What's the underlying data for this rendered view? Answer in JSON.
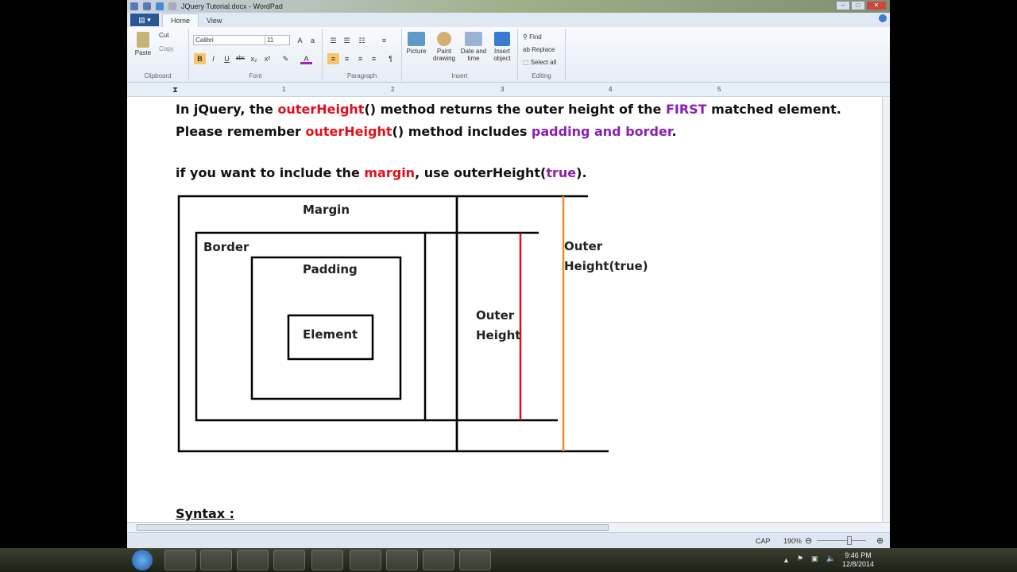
{
  "window": {
    "title": "JQuery Tutorial.docx - WordPad",
    "controls": [
      "–",
      "□",
      "✕"
    ]
  },
  "tabs": [
    {
      "label": "Home",
      "active": true
    },
    {
      "label": "View",
      "active": false
    }
  ],
  "ribbon": {
    "clipboard": {
      "label": "Clipboard",
      "paste": "Paste",
      "cut": "Cut",
      "copy": "Copy"
    },
    "font": {
      "label": "Font",
      "family": "Calibri",
      "size": "11",
      "bold": "B",
      "italic": "I",
      "underline": "U",
      "strike": "abc",
      "sub": "x₂",
      "sup": "x²"
    },
    "paragraph": {
      "label": "Paragraph"
    },
    "insert": {
      "label": "Insert",
      "picture": "Picture",
      "paint": "Paint drawing",
      "datetime": "Date and time",
      "object": "Insert object"
    },
    "editing": {
      "label": "Editing",
      "find": "Find",
      "replace": "Replace",
      "select_all": "Select all"
    }
  },
  "ruler": [
    "1",
    "2",
    "3",
    "4",
    "5"
  ],
  "document": {
    "line0": {
      "a": "In jQuery, the ",
      "b": "outerHeight",
      "c": "() method returns the outer height of the ",
      "d": "FIRST",
      "e": " matched element."
    },
    "line1": {
      "a": "Please remember ",
      "b": "outerHeight",
      "c": "() method includes ",
      "d": "padding and border",
      "e": "."
    },
    "line2": {
      "a": "if you want to include the ",
      "b": "margin",
      "c": ", use outerHeight(",
      "d": "true",
      "e": ")."
    },
    "diagram": {
      "margin": "Margin",
      "border": "Border",
      "padding": "Padding",
      "element": "Element",
      "outer_height": [
        "Outer",
        "Height"
      ],
      "outer_height_true": [
        "Outer",
        "Height(true)"
      ]
    },
    "syntax": "Syntax :"
  },
  "colors": {
    "red": "#e0101a",
    "purple": "#8a1fb0",
    "orange": "#f08a30"
  },
  "status": {
    "caps": "CAP",
    "zoom": "190%",
    "zoom_level_percent": 190
  },
  "taskbar": {
    "time": "9:46 PM",
    "date": "12/8/2014"
  }
}
